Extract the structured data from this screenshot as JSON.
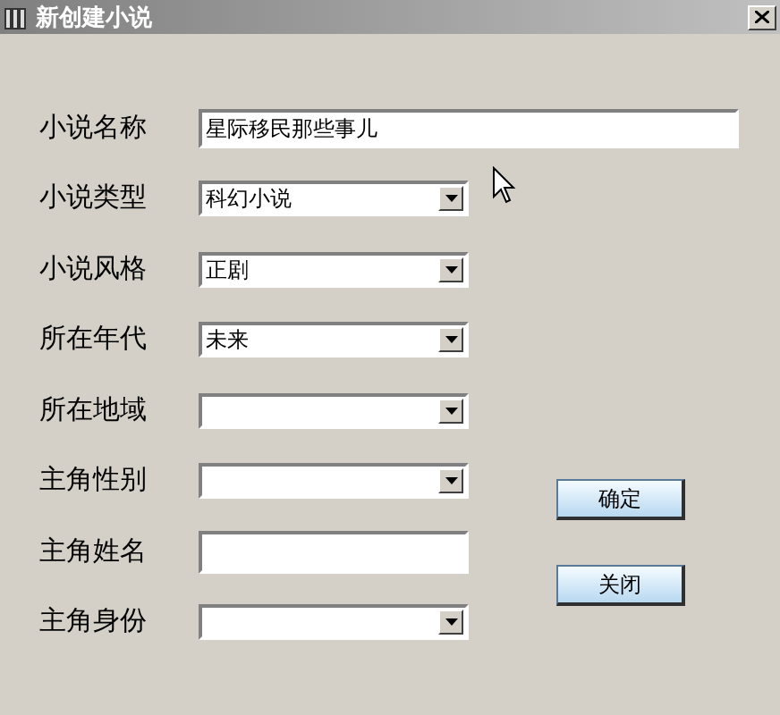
{
  "window": {
    "title": "新创建小说"
  },
  "fields": [
    {
      "label": "小说名称",
      "kind": "text",
      "value": "星际移民那些事儿"
    },
    {
      "label": "小说类型",
      "kind": "combo",
      "value": "科幻小说"
    },
    {
      "label": "小说风格",
      "kind": "combo",
      "value": "正剧"
    },
    {
      "label": "所在年代",
      "kind": "combo",
      "value": "未来"
    },
    {
      "label": "所在地域",
      "kind": "combo"
    },
    {
      "label": "主角性别",
      "kind": "combo"
    },
    {
      "label": "主角姓名",
      "kind": "short_text"
    },
    {
      "label": "主角身份",
      "kind": "combo"
    }
  ],
  "buttons": [
    "确定",
    "关闭"
  ]
}
